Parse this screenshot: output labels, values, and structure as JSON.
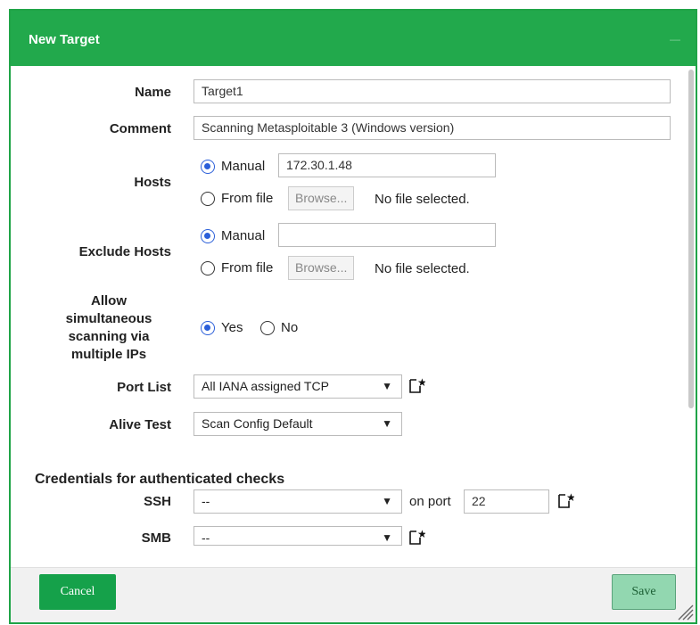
{
  "dialog": {
    "title": "New Target",
    "close_icon": "close-icon"
  },
  "form": {
    "name": {
      "label": "Name",
      "value": "Target1"
    },
    "comment": {
      "label": "Comment",
      "value": "Scanning Metasploitable 3 (Windows version)"
    },
    "hosts": {
      "label": "Hosts",
      "manual_label": "Manual",
      "manual_value": "172.30.1.48",
      "file_label": "From file",
      "browse_label": "Browse...",
      "no_file": "No file selected.",
      "selected": "manual"
    },
    "exclude_hosts": {
      "label": "Exclude Hosts",
      "manual_label": "Manual",
      "manual_value": "",
      "file_label": "From file",
      "browse_label": "Browse...",
      "no_file": "No file selected.",
      "selected": "manual"
    },
    "allow_simultaneous": {
      "label_lines": [
        "Allow",
        "simultaneous",
        "scanning via",
        "multiple IPs"
      ],
      "yes_label": "Yes",
      "no_label": "No",
      "selected": "yes"
    },
    "port_list": {
      "label": "Port List",
      "value": "All IANA assigned TCP",
      "new_icon": "new-item-icon"
    },
    "alive_test": {
      "label": "Alive Test",
      "value": "Scan Config Default"
    },
    "credentials": {
      "heading": "Credentials for authenticated checks",
      "ssh": {
        "label": "SSH",
        "value": "--",
        "on_port_label": "on port",
        "port": "22",
        "new_icon": "new-item-icon"
      },
      "smb": {
        "label": "SMB",
        "value": "--",
        "new_icon": "new-item-icon"
      }
    }
  },
  "footer": {
    "cancel_label": "Cancel",
    "save_label": "Save"
  },
  "colors": {
    "titlebar": "#22a94c",
    "cancel_button": "#15a14a",
    "save_button": "#92d7b0",
    "radio_accent": "#2b5fd9"
  }
}
